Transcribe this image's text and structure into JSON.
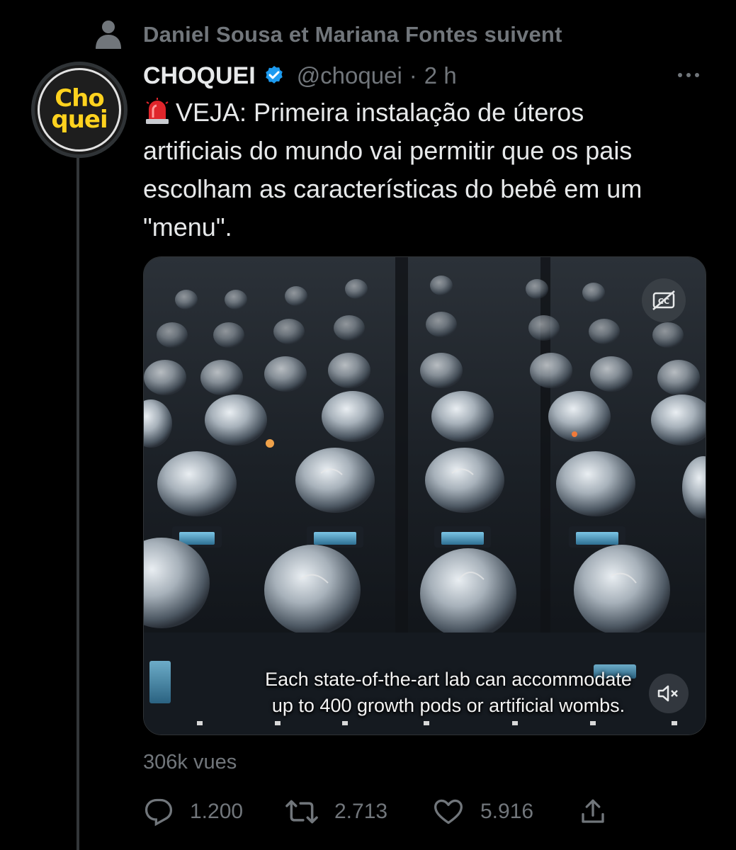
{
  "social_context": {
    "text": "Daniel Sousa et Mariana Fontes suivent",
    "icon": "person-icon"
  },
  "author": {
    "avatar_text_line1": "Cho",
    "avatar_text_line2": "quei",
    "name": "CHOQUEI",
    "verified_icon": "verified-badge-icon",
    "handle": "@choquei",
    "separator": "·",
    "time": "2 h"
  },
  "tweet": {
    "emoji_icon": "police-siren-icon",
    "text": "VEJA: Primeira instalação de úteros\nartificiais do mundo vai permitir que os pais\nescolham as características do bebê em um\n\"menu\"."
  },
  "media": {
    "type": "video",
    "caption_line1": "Each state-of-the-art lab can accommodate",
    "caption_line2": "up to 400 growth pods or artificial wombs.",
    "cc_icon": "closed-captions-off-icon",
    "mute_icon": "volume-muted-icon"
  },
  "views_label": "306k vues",
  "actions": {
    "replies": "1.200",
    "retweets": "2.713",
    "likes": "5.916",
    "reply_icon": "reply-icon",
    "retweet_icon": "retweet-icon",
    "like_icon": "heart-icon",
    "share_icon": "share-icon"
  },
  "colors": {
    "background": "#000000",
    "text_primary": "#e7e9ea",
    "text_secondary": "#71767b",
    "verified_blue": "#1d9bf0",
    "avatar_yellow": "#ffd21f"
  }
}
